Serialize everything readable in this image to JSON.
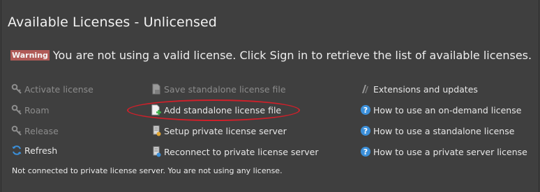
{
  "header": {
    "title": "Available Licenses - Unlicensed"
  },
  "warning": {
    "badge": "Warning",
    "message": "You are not using a valid license. Click Sign in to retrieve the list of available licenses."
  },
  "actions": {
    "col1": [
      {
        "label": "Activate license",
        "icon": "key-icon",
        "enabled": false
      },
      {
        "label": "Roam",
        "icon": "roam-key-icon",
        "enabled": false
      },
      {
        "label": "Release",
        "icon": "release-key-icon",
        "enabled": false
      },
      {
        "label": "Refresh",
        "icon": "refresh-icon",
        "enabled": true
      }
    ],
    "col2": [
      {
        "label": "Save standalone license file",
        "icon": "save-file-icon",
        "enabled": false
      },
      {
        "label": "Add standalone license file",
        "icon": "add-file-icon",
        "enabled": true
      },
      {
        "label": "Setup private license server",
        "icon": "server-setup-icon",
        "enabled": true
      },
      {
        "label": "Reconnect to private license server",
        "icon": "server-reconnect-icon",
        "enabled": true
      }
    ],
    "col3": [
      {
        "label": "Extensions and updates",
        "icon": "extensions-icon",
        "enabled": true
      },
      {
        "label": "How to use an on-demand license",
        "icon": "help-icon",
        "enabled": true
      },
      {
        "label": "How to use a standalone license",
        "icon": "help-icon",
        "enabled": true
      },
      {
        "label": "How to use a private server license",
        "icon": "help-icon",
        "enabled": true
      }
    ]
  },
  "status": "Not connected to private license server. You are not using any license.",
  "colors": {
    "background": "#3f3f3f",
    "warning_badge": "#b05b57",
    "highlight": "#d0202a",
    "link_blue": "#3b8fd9"
  }
}
